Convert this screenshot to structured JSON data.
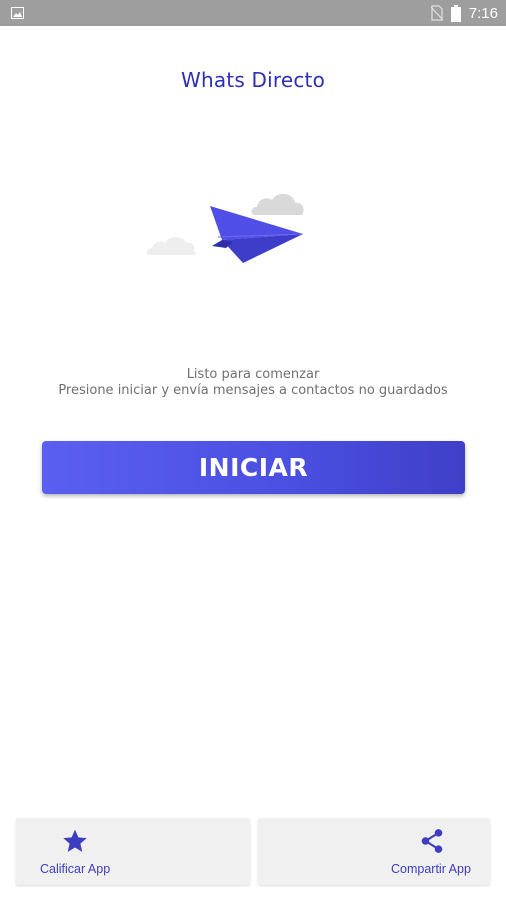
{
  "status_bar": {
    "time": "7:16",
    "icons": [
      "image-icon",
      "no-sim-icon",
      "battery-icon"
    ]
  },
  "app": {
    "title": "Whats Directo"
  },
  "illustration": {
    "icons": [
      "paper-plane-icon",
      "cloud-icon"
    ],
    "colors": {
      "plane": "#4f4fe8",
      "cloud": "#d9d9d9"
    }
  },
  "main": {
    "subtitle_line1": "Listo para comenzar",
    "subtitle_line2": "Presione iniciar y envía mensajes a contactos no guardados",
    "start_label": "INICIAR"
  },
  "bottom_actions": {
    "rate": {
      "label": "Calificar App",
      "icon": "star-icon"
    },
    "share": {
      "label": "Compartir App",
      "icon": "share-icon"
    }
  },
  "colors": {
    "accent": "#4a4fe0",
    "title": "#2f2fb4",
    "status_bar": "#9e9e9e"
  }
}
